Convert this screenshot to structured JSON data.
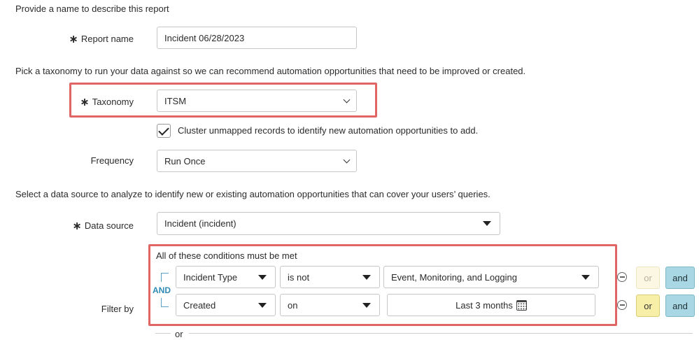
{
  "instructions": {
    "name": "Provide a name to describe this report",
    "taxonomy": "Pick a taxonomy to run your data against so we can recommend automation opportunities that need to be improved or created.",
    "datasource": "Select a data source to analyze to identify new or existing automation opportunities that can cover your users’ queries."
  },
  "form": {
    "report_name": {
      "label": "Report name",
      "required_mark": "∗",
      "value": "Incident 06/28/2023"
    },
    "taxonomy": {
      "label": "Taxonomy",
      "required_mark": "∗",
      "value": "ITSM"
    },
    "cluster": {
      "checked": true,
      "label": "Cluster unmapped records to identify new automation opportunities to add."
    },
    "frequency": {
      "label": "Frequency",
      "value": "Run Once"
    },
    "data_source": {
      "label": "Data source",
      "required_mark": "∗",
      "value": "Incident (incident)"
    }
  },
  "filter": {
    "label": "Filter by",
    "header": "All of these conditions must be met",
    "and_label": "AND",
    "conditions": [
      {
        "field": "Incident Type",
        "operator": "is not",
        "value": "Event, Monitoring, and Logging",
        "or_label": "or",
        "and_label": "and",
        "or_disabled": true
      },
      {
        "field": "Created",
        "operator": "on",
        "value": "Last 3 months",
        "or_label": "or",
        "and_label": "and",
        "or_disabled": false
      }
    ],
    "or_separator": "or"
  },
  "colors": {
    "highlight": "#e06666",
    "and_button": "#a9d7e3",
    "or_button": "#f7efa7",
    "and_label": "#2e8bb6"
  }
}
